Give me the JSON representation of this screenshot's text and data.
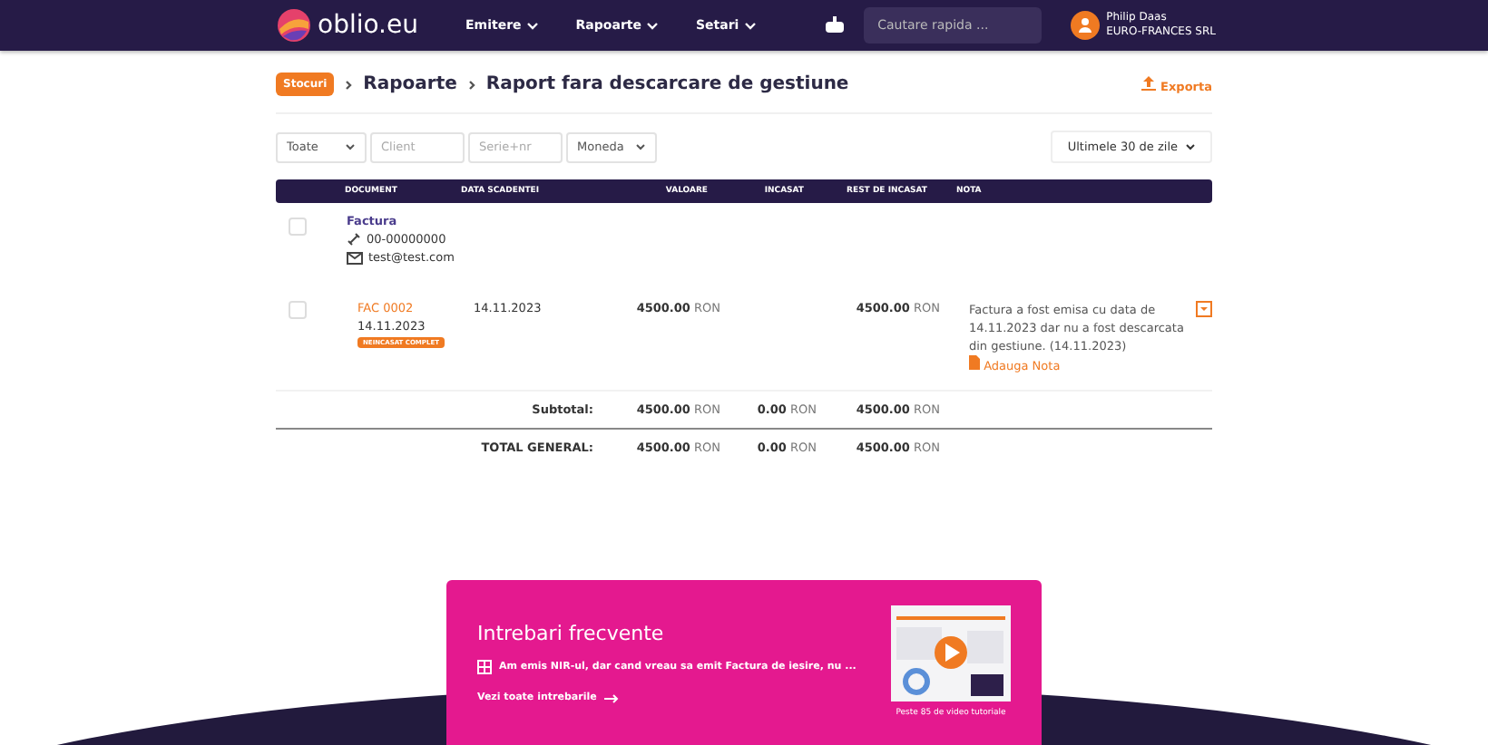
{
  "nav": {
    "logo": "oblio.eu",
    "menus": [
      "Emitere",
      "Rapoarte",
      "Setari"
    ],
    "search": {
      "placeholder": "Cautare rapida ..."
    },
    "user": {
      "name": "Philip Daas",
      "company": "EURO-FRANCES SRL"
    }
  },
  "breadcrumb": {
    "badge": "Stocuri",
    "items": [
      "Rapoarte",
      "Raport fara descarcare de gestiune"
    ]
  },
  "export": "Exporta",
  "filters": [
    {
      "kind": "select",
      "text": "Toate"
    },
    {
      "kind": "input",
      "placeholder": "Client"
    },
    {
      "kind": "input",
      "placeholder": "Serie+nr"
    },
    {
      "kind": "select",
      "text": "Moneda"
    }
  ],
  "period": "Ultimele 30 de zile",
  "table": {
    "columns": [
      "DOCUMENT",
      "DATA SCADENTEI",
      "VALOARE",
      "INCASAT",
      "REST DE INCASAT",
      "NOTA"
    ],
    "client": {
      "type": "Factura",
      "phone": "00-00000000",
      "email": "test@test.com",
      "checked": false
    },
    "rows": [
      {
        "doc": "FAC 0002",
        "date": "14.11.2023",
        "badge": "NEINCASAT COMPLET",
        "due": "14.11.2023",
        "value": "4500.00",
        "cur1": "RON",
        "rest": "4500.00",
        "cur2": "RON",
        "note": "Factura a fost emisa cu data de 14.11.2023 dar nu a fost descarcata din gestiune. (14.11.2023)",
        "add_note": "Adauga Nota",
        "checked": false
      }
    ],
    "totals": [
      {
        "label": "Subtotal:",
        "values": [
          [
            "4500.00",
            "RON"
          ],
          [
            "0.00",
            "RON"
          ],
          [
            "4500.00",
            "RON"
          ]
        ]
      },
      {
        "label": "TOTAL GENERAL:",
        "values": [
          [
            "4500.00",
            "RON"
          ],
          [
            "0.00",
            "RON"
          ],
          [
            "4500.00",
            "RON"
          ]
        ]
      }
    ]
  },
  "faq": {
    "title": "Intrebari frecvente",
    "question": "Am emis NIR-ul, dar cand vreau sa emit Factura de iesire, nu ...",
    "link": "Vezi toate intrebarile",
    "video_caption": "Peste 85 de video tutoriale"
  }
}
